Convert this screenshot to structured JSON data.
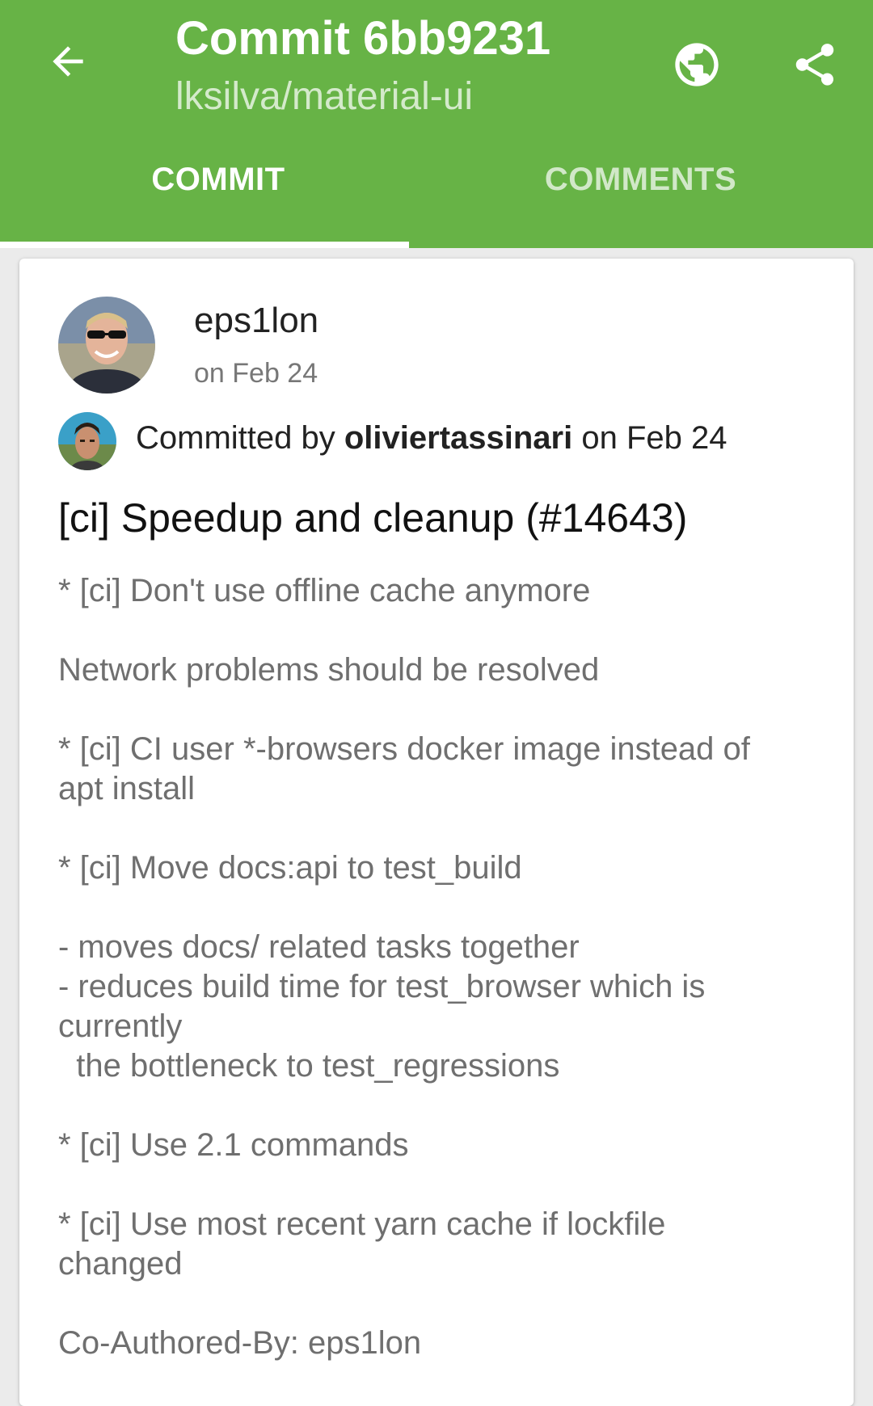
{
  "header": {
    "title": "Commit 6bb9231",
    "subtitle": "lksilva/material-ui",
    "back_icon": "arrow-left-icon",
    "globe_icon": "globe-icon",
    "share_icon": "share-icon"
  },
  "tabs": [
    {
      "label": "COMMIT",
      "active": true
    },
    {
      "label": "COMMENTS",
      "active": false
    }
  ],
  "commit": {
    "author": "eps1lon",
    "author_date": "on Feb 24",
    "committed_prefix": "Committed by ",
    "committer": "oliviertassinari",
    "committed_suffix": " on Feb 24",
    "title": "[ci] Speedup and cleanup (#14643)",
    "body": "* [ci] Don't use offline cache anymore\n\nNetwork problems should be resolved\n\n* [ci] CI user *-browsers docker image instead of\napt install\n\n* [ci] Move docs:api to test_build\n\n- moves docs/ related tasks together\n- reduces build time for test_browser which is\ncurrently\n  the bottleneck to test_regressions\n\n* [ci] Use 2.1 commands\n\n* [ci] Use most recent yarn cache if lockfile\nchanged\n\nCo-Authored-By: eps1lon"
  },
  "colors": {
    "primary": "#67b346",
    "card": "#ffffff",
    "background": "#ebebeb"
  }
}
